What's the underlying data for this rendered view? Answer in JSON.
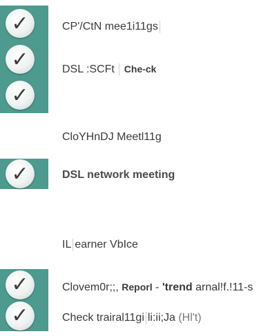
{
  "colors": {
    "badge": "#4d9b8e",
    "text": "#3a3a3a"
  },
  "icons": {
    "check": "check-circle-icon",
    "check_glyph": "✓"
  },
  "items": [
    {
      "text": "CP'/CtN mee1i11gs",
      "checked": true
    },
    {
      "text": "DSL :SCFt",
      "extra": "Che-ck",
      "checked": true
    },
    {
      "text": "",
      "checked": true
    },
    {
      "text": "CloYHnDJ Meetl11g",
      "checked": false
    },
    {
      "text": "DSL network meeting",
      "checked": true
    },
    {
      "text_a": "IL",
      "text_b": "earner VbIce",
      "checked": false
    },
    {
      "text_a": "Clovem0r;;,",
      "bold_a": "Reporl",
      "sep": "-",
      "bold_b": "'trend",
      "tail": "arnal!f.!11-s",
      "checked": true
    },
    {
      "text_a": "Check trairal11gi",
      "text_b": "li:ii;Ja",
      "paren": "(Hl't)",
      "checked": true
    }
  ]
}
